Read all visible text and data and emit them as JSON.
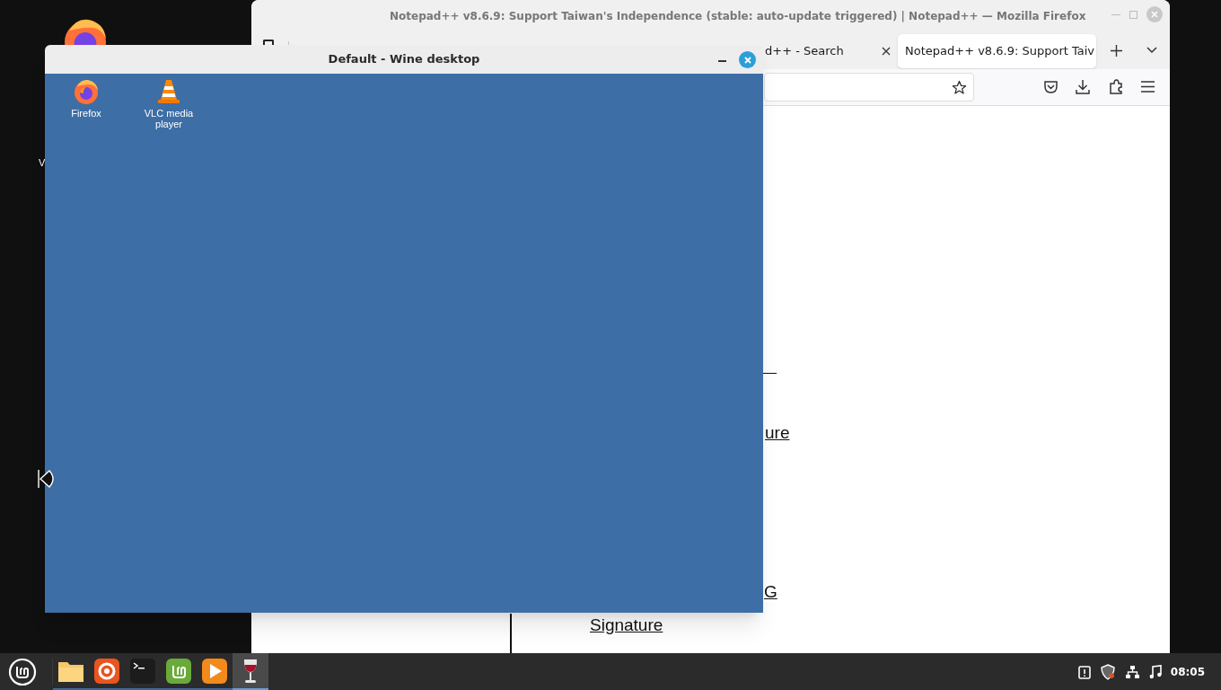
{
  "desktop": {
    "label_fragment": "V"
  },
  "browser_window": {
    "title": "Notepad++ v8.6.9: Support Taiwan's Independence (stable: auto-update triggered) | Notepad++ — Mozilla Firefox",
    "tabs": [
      {
        "label": "d++ - Search",
        "selected": false
      },
      {
        "label": "Notepad++ v8.6.9: Support Taiv",
        "selected": true
      }
    ],
    "page_links": [
      {
        "text": "ure"
      },
      {
        "text": "G"
      },
      {
        "text": "Signature"
      }
    ]
  },
  "wine_window": {
    "title": "Default - Wine desktop",
    "icons": [
      {
        "label": "Firefox",
        "kind": "firefox"
      },
      {
        "label": "VLC media player",
        "kind": "vlc"
      }
    ]
  },
  "taskbar": {
    "apps": [
      {
        "kind": "files",
        "active": false
      },
      {
        "kind": "firefox",
        "active": false
      },
      {
        "kind": "terminal",
        "active": false
      },
      {
        "kind": "mint",
        "active": false
      },
      {
        "kind": "player",
        "active": false
      },
      {
        "kind": "wine",
        "active": true
      }
    ],
    "clock": "08:05"
  }
}
